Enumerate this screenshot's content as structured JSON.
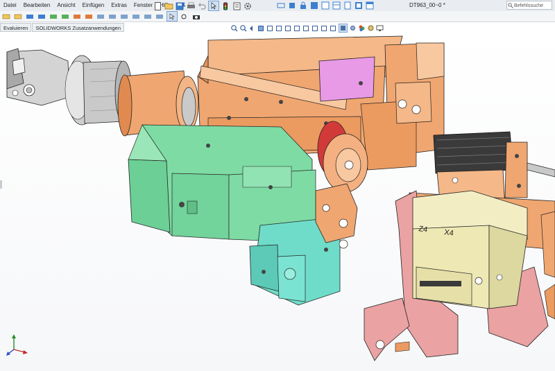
{
  "menubar": {
    "items": [
      "Datei",
      "Bearbeiten",
      "Ansicht",
      "Einfügen",
      "Extras",
      "Fenster",
      "Hilfe"
    ]
  },
  "document_title": "DT963_00~0 *",
  "search": {
    "placeholder": "Befehlssuche"
  },
  "command_tabs": [
    "Evaluieren",
    "SOLIDWORKS Zusatzanwendungen"
  ],
  "colors": {
    "orange": "#f0a670",
    "green": "#7edba4",
    "teal": "#6fdcc9",
    "yellow": "#eee8b4",
    "pink": "#eaa2a2",
    "magenta": "#e89ae6",
    "grey_part": "#c9c9c9",
    "dark_part": "#3a3a3a"
  },
  "icons": [
    "pin-icon",
    "new-icon",
    "open-icon",
    "save-icon",
    "print-icon",
    "undo-icon",
    "select-icon",
    "rebuild-icon",
    "options-icon"
  ],
  "labels": {
    "z": "Z4",
    "x": "X4"
  }
}
